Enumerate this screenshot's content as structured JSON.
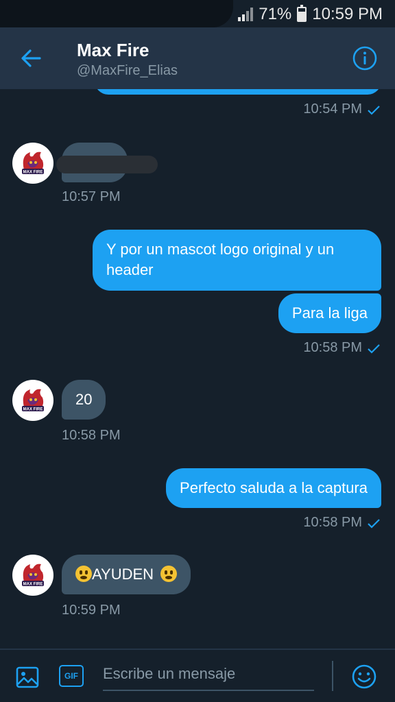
{
  "status_bar": {
    "battery": "71%",
    "time": "10:59 PM"
  },
  "header": {
    "name": "Max Fire",
    "handle": "@MaxFire_Elias"
  },
  "messages": [
    {
      "id": "m0",
      "direction": "out",
      "text": "",
      "time": "10:54 PM"
    },
    {
      "id": "m1",
      "direction": "in",
      "text": "",
      "time": "10:57 PM"
    },
    {
      "id": "m2",
      "direction": "out",
      "text": "Y por un mascot logo original y un header"
    },
    {
      "id": "m3",
      "direction": "out",
      "text": "Para la liga",
      "time": "10:58 PM"
    },
    {
      "id": "m4",
      "direction": "in",
      "text": "20",
      "time": "10:58 PM"
    },
    {
      "id": "m5",
      "direction": "out",
      "text": "Perfecto saluda a la captura",
      "time": "10:58 PM"
    },
    {
      "id": "m6",
      "direction": "in",
      "text": "AYUDEN",
      "time": "10:59 PM"
    }
  ],
  "composer": {
    "placeholder": "Escribe un mensaje",
    "gif_label": "GIF"
  },
  "avatar_logo_text": "MAX FIRE",
  "colors": {
    "background": "#15202b",
    "header": "#243447",
    "accent": "#1da1f2",
    "incoming_bubble": "#3d5466",
    "muted_text": "#8899a6"
  }
}
